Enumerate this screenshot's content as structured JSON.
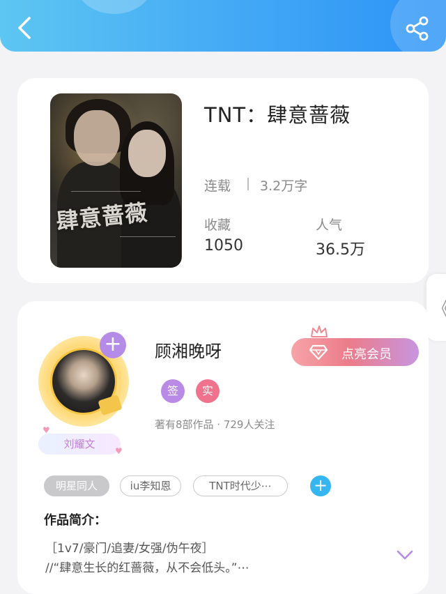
{
  "header": {
    "back_icon": "chevron-left-icon",
    "share_icon": "share-icon",
    "gradient": [
      "#5ec6f2",
      "#2b93f7"
    ]
  },
  "book": {
    "cover_title": "肆意蔷薇",
    "title": "TNT：肆意蔷薇",
    "status": "连载",
    "word_count": "3.2万字",
    "favorites_label": "收藏",
    "favorites_value": "1050",
    "popularity_label": "人气",
    "popularity_value": "36.5万"
  },
  "side_tab": {
    "icon": "chevron-left-icon",
    "glyph": "《"
  },
  "author": {
    "name": "顾湘晚呀",
    "fan_badge": "刘耀文",
    "badges": [
      {
        "label": "签",
        "color": "#b98be6"
      },
      {
        "label": "实",
        "color": "#f0728c"
      }
    ],
    "meta": "著有8部作品 · 729人关注",
    "add_glyph": "+",
    "vip_button": "点亮会员",
    "vip_colors": [
      "#f6a4a8",
      "#c795e0"
    ]
  },
  "tags": [
    "明星同人",
    "iu李知恩",
    "TNT时代少⋯"
  ],
  "tag_add_glyph": "+",
  "intro": {
    "label": "作品简介：",
    "lines": [
      "［1v7/豪门/追妻/女强/伪午夜］",
      "//“肆意生长的红蔷薇，从不会低头。”⋯"
    ]
  }
}
